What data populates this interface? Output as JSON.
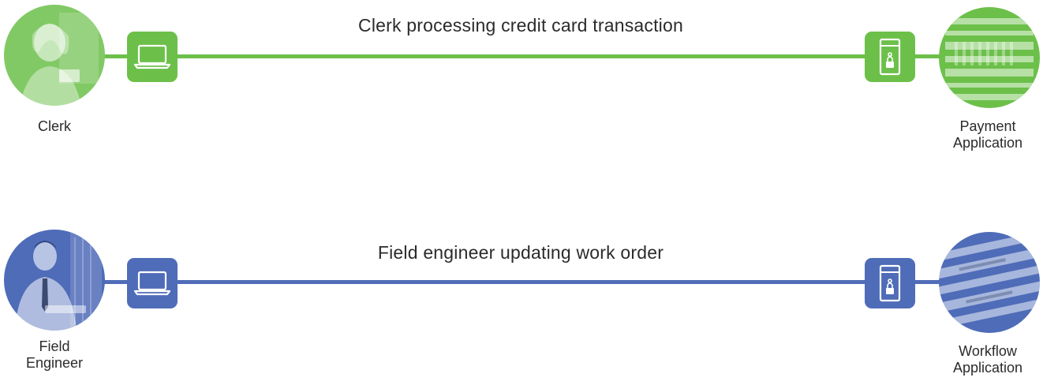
{
  "colors": {
    "green": "#6cc04a",
    "blue": "#4f6cb8"
  },
  "flows": [
    {
      "theme": "green",
      "caption": "Clerk processing credit card transaction",
      "source": {
        "label_lines": [
          "Clerk"
        ],
        "photo": "clerk-photo"
      },
      "source_device": {
        "icon": "laptop-icon"
      },
      "target_device": {
        "icon": "server-lock-icon"
      },
      "target": {
        "label_lines": [
          "Payment",
          "Application"
        ],
        "photo": "server-rack-photo"
      }
    },
    {
      "theme": "blue",
      "caption": "Field engineer updating work order",
      "source": {
        "label_lines": [
          "Field",
          "Engineer"
        ],
        "photo": "field-engineer-photo"
      },
      "source_device": {
        "icon": "laptop-icon"
      },
      "target_device": {
        "icon": "server-lock-icon"
      },
      "target": {
        "label_lines": [
          "Workflow",
          "Application"
        ],
        "photo": "server-rack-photo"
      }
    }
  ]
}
